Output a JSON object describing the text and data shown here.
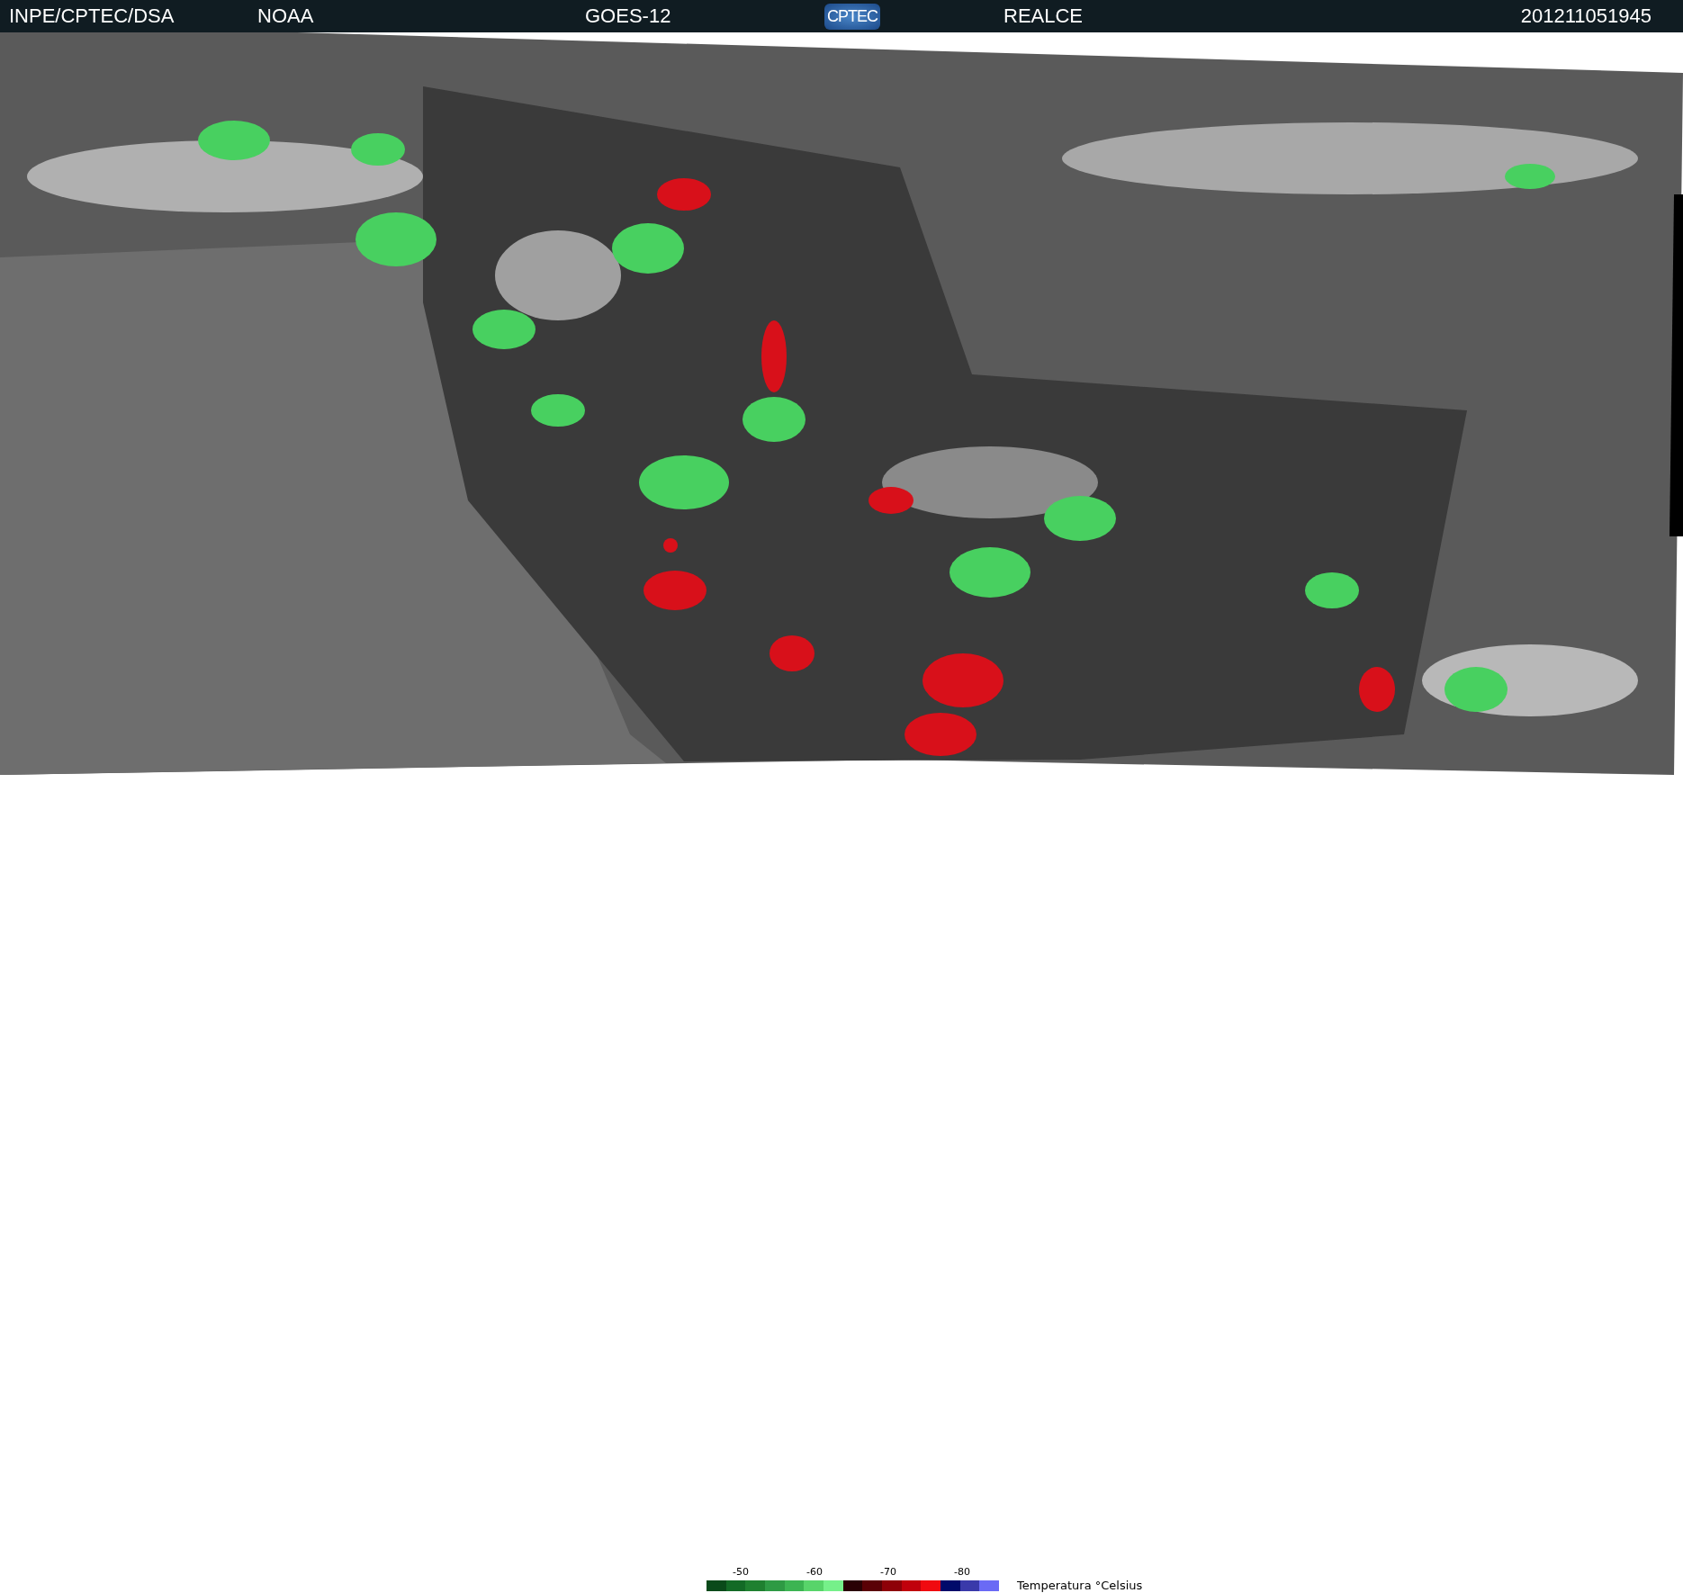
{
  "header": {
    "source": "INPE/CPTEC/DSA",
    "agency": "NOAA",
    "satellite": "GOES-12",
    "logo": "CPTEC",
    "product": "REALCE",
    "timestamp": "201211051945"
  },
  "legend": {
    "ticks": [
      "-50",
      "-60",
      "-70",
      "-80"
    ],
    "title": "Temperatura  °Celsius",
    "swatches": [
      {
        "color": "#0a4a1a"
      },
      {
        "color": "#136a26"
      },
      {
        "color": "#1f8030"
      },
      {
        "color": "#2e9a44"
      },
      {
        "color": "#3cb452"
      },
      {
        "color": "#58d46a"
      },
      {
        "color": "#76f08a"
      },
      {
        "color": "#2a0004"
      },
      {
        "color": "#5a0006"
      },
      {
        "color": "#8e0008"
      },
      {
        "color": "#c0000c"
      },
      {
        "color": "#f00a10"
      },
      {
        "color": "#000a6a"
      },
      {
        "color": "#3a3aaa"
      },
      {
        "color": "#6a6af5"
      }
    ]
  }
}
